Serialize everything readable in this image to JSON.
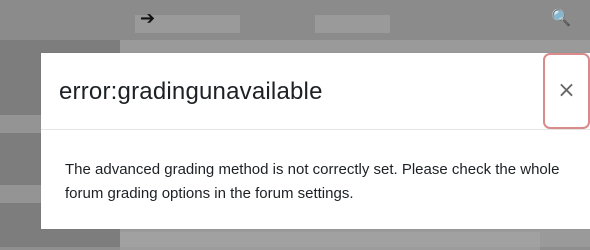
{
  "background": {
    "topbar": {
      "arrow_icon_glyph": "➔",
      "search_icon_glyph": "🔍"
    }
  },
  "modal": {
    "title": "error:gradingunavailable",
    "close_glyph": "×",
    "body_text": "The advanced grading method is not correctly set. Please check the whole forum grading options in the forum settings."
  },
  "colors": {
    "overlay": "#9a9a9a",
    "modal_bg": "#ffffff",
    "title_text": "#1d2125",
    "close_focus_border": "#d98b8b"
  },
  "icons": [
    "arrow-right-icon",
    "search-icon",
    "close-icon"
  ]
}
